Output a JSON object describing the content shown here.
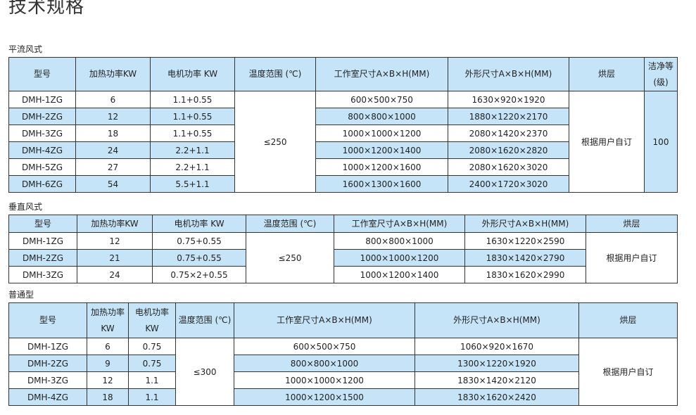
{
  "page_title": "技术规格",
  "sections": [
    {
      "label": "平流风式",
      "headers": [
        "型号",
        "加热功率KW",
        "电机功率 KW",
        "温度范围 (℃)",
        "工作室尺寸A×B×H(MM)",
        "外形尺寸A×B×H(MM)",
        "烘层",
        "洁净等(级)"
      ],
      "rows": [
        [
          "DMH-1ZG",
          "6",
          "1.1+0.55",
          "600×500×750",
          "1630×920×1920"
        ],
        [
          "DMH-2ZG",
          "12",
          "1.1+0.55",
          "800×800×1000",
          "1880×1220×2170"
        ],
        [
          "DMH-3ZG",
          "18",
          "1.1+0.55",
          "1000×1000×1200",
          "2080×1420×2370"
        ],
        [
          "DMH-4ZG",
          "24",
          "2.2+1.1",
          "1000×1200×1400",
          "2080×1620×2820"
        ],
        [
          "DMH-5ZG",
          "27",
          "2.2+1.1",
          "1000×1200×1600",
          "2080×1620×3020"
        ],
        [
          "DMH-6ZG",
          "54",
          "5.5+1.1",
          "1600×1300×1600",
          "2400×1720×3020"
        ]
      ],
      "temp": "≤250",
      "layers": "根据用户自订",
      "clean": "100"
    },
    {
      "label": "垂直风式",
      "headers": [
        "型号",
        "加热功率KW",
        "电机功率 KW",
        "温度范围 (℃)",
        "工作室尺寸A×B×H(MM)",
        "外形尺寸A×B×H(MM)",
        "烘层"
      ],
      "rows": [
        [
          "DMH-1ZG",
          "12",
          "0.75+0.55",
          "800×800×1000",
          "1630×1220×2590"
        ],
        [
          "DMH-2ZG",
          "21",
          "0.75+0.55",
          "1000×1000×1200",
          "1830×1420×2790"
        ],
        [
          "DMH-3ZG",
          "24",
          "0.75×2+0.55",
          "1000×1200×1400",
          "1830×1620×2990"
        ]
      ],
      "temp": "≤250",
      "layers": "根据用户自订"
    },
    {
      "label": "普通型",
      "headers": [
        "型号",
        "加热功率KW",
        "电机功率KW",
        "温度范围 (℃)",
        "工作室尺寸A×B×H(MM)",
        "外形尺寸A×B×H(MM)",
        "烘层"
      ],
      "rows": [
        [
          "DMH-1ZG",
          "6",
          "0.75",
          "600×500×750",
          "1060×920×1670"
        ],
        [
          "DMH-2ZG",
          "9",
          "0.75",
          "800×800×1000",
          "1300×1220×1920"
        ],
        [
          "DMH-3ZG",
          "12",
          "1.1",
          "1000×1000×1200",
          "1830×1420×2120"
        ],
        [
          "DMH-4ZG",
          "18",
          "1.1",
          "1000×1200×1500",
          "1830×1620×2420"
        ]
      ],
      "temp": "≤300",
      "layers": "根据用户自订"
    }
  ]
}
